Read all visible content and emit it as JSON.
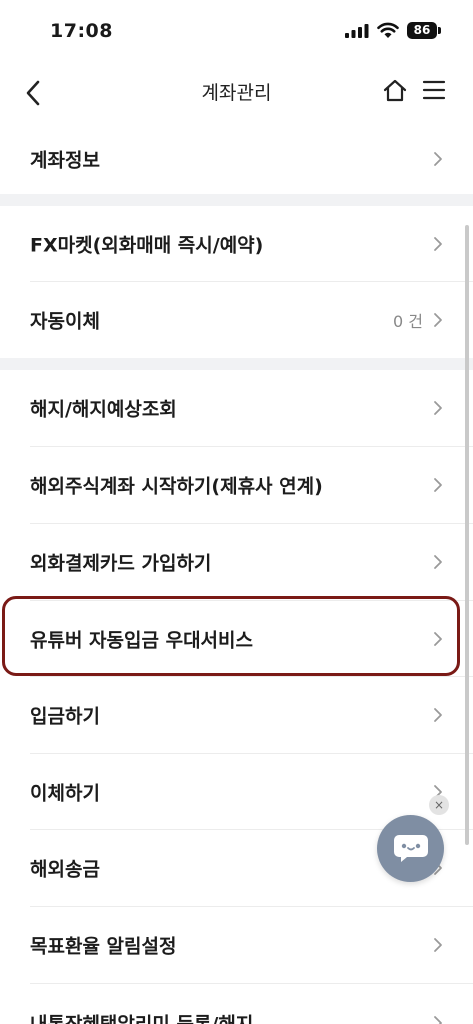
{
  "status_bar": {
    "time": "17:08",
    "battery": "86"
  },
  "header": {
    "title": "계좌관리",
    "icons": [
      "back-icon",
      "home-icon",
      "menu-icon"
    ]
  },
  "sections": [
    {
      "items": [
        {
          "label": "계좌정보"
        }
      ]
    },
    {
      "items": [
        {
          "label": "FX마켓(외화매매 즉시/예약)"
        },
        {
          "label": "자동이체",
          "value": "0 건"
        }
      ]
    },
    {
      "items": [
        {
          "label": "해지/해지예상조회"
        },
        {
          "label": "해외주식계좌 시작하기(제휴사 연계)"
        },
        {
          "label": "외화결제카드 가입하기"
        },
        {
          "label": "유튜버 자동입금 우대서비스",
          "highlighted": true
        },
        {
          "label": "입금하기"
        },
        {
          "label": "이체하기"
        },
        {
          "label": "해외송금"
        },
        {
          "label": "목표환율 알림설정"
        },
        {
          "label": "내통장혜택알리미 등록/해지"
        }
      ]
    }
  ],
  "chat": {
    "close_label": "×",
    "icon": "chat-bubble-icon"
  },
  "colors": {
    "highlight": "#7a1a16",
    "chat_button": "#7f8ea3",
    "divider": "#f1f2f4"
  }
}
